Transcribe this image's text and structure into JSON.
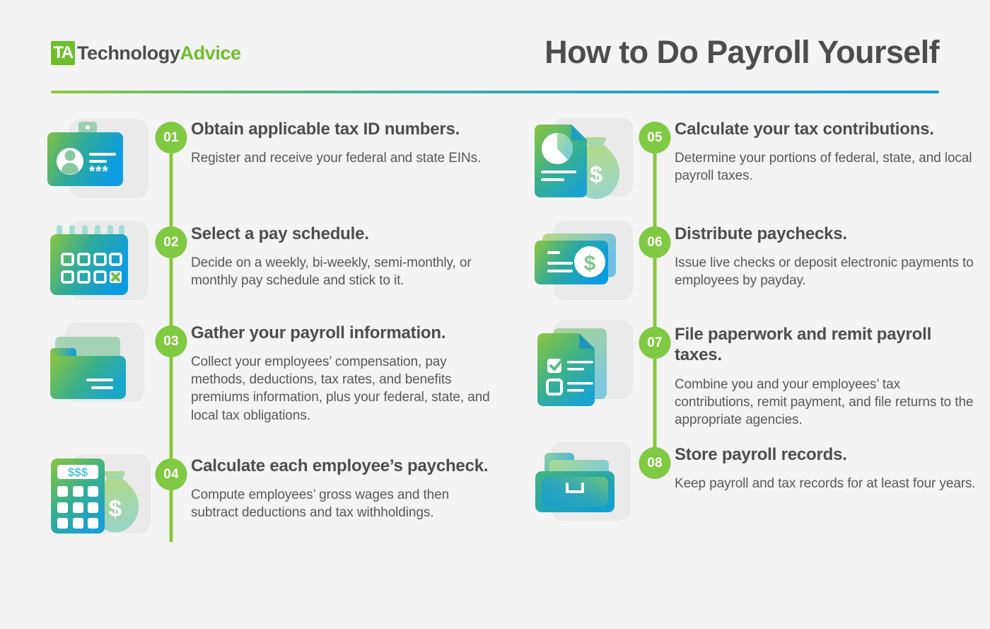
{
  "header": {
    "logo": {
      "mark": "TA",
      "word_dark": "Technology",
      "word_green": "Advice",
      "icon": "ta-logo-icon"
    },
    "title": "How to Do Payroll Yourself",
    "divider_gradient": [
      "#8cc63e",
      "#0d9ce0"
    ]
  },
  "theme": {
    "background": "#f4f4f4",
    "accent_green": "#80c942",
    "title_color": "#4d4d4d",
    "body_color": "#58585b",
    "icon_gradient_start": "#8cc63e",
    "icon_gradient_end": "#0d9ce0"
  },
  "steps": [
    {
      "number": "01",
      "title": "Obtain applicable tax ID numbers.",
      "desc": "Register and receive your federal and state EINs.",
      "icon": "id-badge-card-icon"
    },
    {
      "number": "02",
      "title": "Select a pay schedule.",
      "desc": "Decide on a weekly, bi-weekly, semi-monthly, or monthly pay schedule and stick to it.",
      "icon": "calendar-icon"
    },
    {
      "number": "03",
      "title": "Gather your payroll information.",
      "desc": "Collect your employees’ compensation, pay methods, deductions, tax rates, and benefits premiums information, plus your federal, state, and local tax obligations.",
      "icon": "folder-icon"
    },
    {
      "number": "04",
      "title": "Calculate each employee’s paycheck.",
      "desc": "Compute employees’ gross wages and then subtract deductions and tax withholdings.",
      "icon": "calculator-money-bag-icon"
    },
    {
      "number": "05",
      "title": "Calculate your tax contributions.",
      "desc": "Determine your portions of federal, state, and local payroll taxes.",
      "icon": "pie-chart-document-money-bag-icon"
    },
    {
      "number": "06",
      "title": "Distribute paychecks.",
      "desc": "Issue live checks or deposit electronic payments to employees by payday.",
      "icon": "paycheck-dollar-icon"
    },
    {
      "number": "07",
      "title": "File paperwork and remit payroll taxes.",
      "desc": "Combine you and your employees’ tax contributions, remit payment, and file returns to the appropriate agencies.",
      "icon": "checklist-document-icon"
    },
    {
      "number": "08",
      "title": "Store payroll records.",
      "desc": "Keep payroll and tax records for at least four years.",
      "icon": "file-cabinet-drawer-icon"
    }
  ]
}
